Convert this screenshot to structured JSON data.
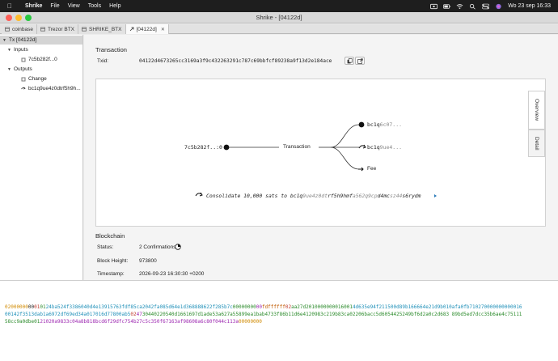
{
  "menubar": {
    "app_name": "Shrike",
    "items": [
      "File",
      "View",
      "Tools",
      "Help"
    ],
    "clock": "Wo 23 sep  16:33"
  },
  "window": {
    "title": "Shrike - [04122d]"
  },
  "tabs": [
    {
      "label": "coinbase",
      "active": false,
      "closable": false
    },
    {
      "label": "Trezor BTX",
      "active": false,
      "closable": false
    },
    {
      "label": "SHRIKE_BTX",
      "active": false,
      "closable": false
    },
    {
      "label": "[04122d]",
      "active": true,
      "closable": true
    }
  ],
  "sidebar": {
    "root": "Tx [04122d]",
    "inputs_label": "Inputs",
    "input_item": "7c5b282f...0",
    "outputs_label": "Outputs",
    "output_change": "Change",
    "output_addr": "bc1q9ue4z0dtrf5h9h..."
  },
  "transaction": {
    "heading": "Transaction",
    "txid_label": "Txid:",
    "txid": "04122d4673265cc3169a3f9c432263291c787c69bbfcf89238a9f13d2e184ace"
  },
  "diagram": {
    "input_label": "7c5b282f..:0",
    "center_label": "Transaction",
    "out1_prefix": "bc1q",
    "out1_rest": "6c07...",
    "out2_prefix": "bc1q",
    "out2_rest": "9ue4...",
    "fee_label": "Fee",
    "memo_prefix": "Consolidate 10,000 sats to ",
    "memo_addr1": "bc1q",
    "memo_addr2": "9ue4z0dt",
    "memo_addr3": "rf5h9hmf",
    "memo_addr4": "a562q9cp",
    "memo_addr5": "d4mc",
    "memo_addr6": "sz44",
    "memo_addr7": "s6rydm",
    "side_tabs": [
      "Overview",
      "Detail"
    ]
  },
  "blockchain": {
    "heading": "Blockchain",
    "status_label": "Status:",
    "status_value": "2 Confirmations",
    "height_label": "Block Height:",
    "height_value": "973800",
    "timestamp_label": "Timestamp:",
    "timestamp_value": "2026-09-23 16:30:30 +0200"
  },
  "hex": {
    "line1": [
      {
        "t": "02000000",
        "c": "#d08a00"
      },
      {
        "t": "00",
        "c": "#222222"
      },
      {
        "t": "01",
        "c": "#c0392b"
      },
      {
        "t": "01",
        "c": "#2a8a2a"
      },
      {
        "t": "24ba524f3386040d4e13915763fdf85ca2042fa085d64e1d368888622f285b7c",
        "c": "#1e8fb8"
      },
      {
        "t": "00000000",
        "c": "#2a8a2a"
      },
      {
        "t": "00",
        "c": "#9c27b0"
      },
      {
        "t": "fdffffff",
        "c": "#c05a00"
      },
      {
        "t": "02",
        "c": "#c0392b"
      },
      {
        "t": "aa27d2010000000016001",
        "c": "#2a8a2a"
      },
      {
        "t": "4d635e94f211500d89b166664e21d9b010afa0fb710270000000000016",
        "c": "#1e8fb8"
      }
    ],
    "line2": [
      {
        "t": "0014",
        "c": "#1e8fb8"
      },
      {
        "t": "2f3513dab1a6972df69ed34a017016d77800ab5",
        "c": "#1e8fb8"
      },
      {
        "t": "02",
        "c": "#c0392b"
      },
      {
        "t": "47",
        "c": "#9c27b0"
      },
      {
        "t": "30440220540d1661697d1ade53a627a55899ea1bab4733f86b11d6e4120983c219b83ca02206bacc5d6054425249bf6d2a0c2d683 89bd5ed7dcc35b6ae4c75111",
        "c": "#2a8a2a"
      }
    ],
    "line3": [
      {
        "t": "58cc9a0dbe01",
        "c": "#2a8a2a"
      },
      {
        "t": "21020a9833c04a8b818bcd6f29dfc754b27c5c350f67163af98608a6c80f044c113a",
        "c": "#9c27b0"
      },
      {
        "t": "00000000",
        "c": "#d08a00"
      }
    ]
  }
}
